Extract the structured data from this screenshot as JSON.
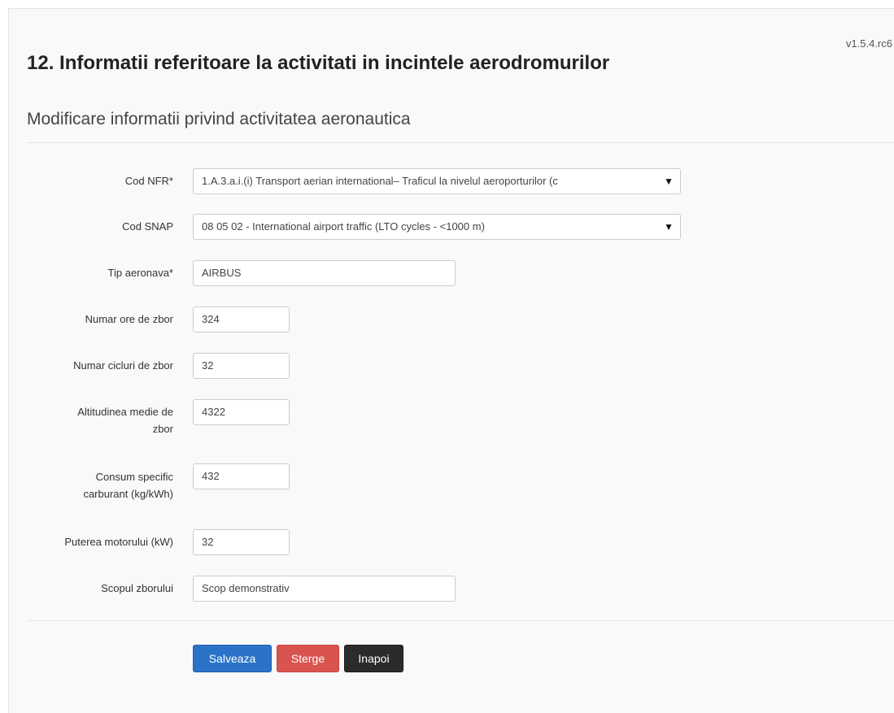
{
  "version": "v1.5.4.rc6",
  "page_title": "12. Informatii referitoare la activitati in incintele aerodromurilor",
  "subtitle": "Modificare informatii privind activitatea aeronautica",
  "form": {
    "cod_nfr": {
      "label": "Cod NFR*",
      "value": "1.A.3.a.i.(i) Transport aerian international– Traficul la nivelul aeroporturilor (c"
    },
    "cod_snap": {
      "label": "Cod SNAP",
      "value": "08 05 02 - International airport traffic (LTO cycles - <1000 m)"
    },
    "tip_aeronava": {
      "label": "Tip aeronava*",
      "value": "AIRBUS"
    },
    "numar_ore": {
      "label": "Numar ore de zbor",
      "value": "324"
    },
    "numar_cicluri": {
      "label": "Numar cicluri de zbor",
      "value": "32"
    },
    "altitudinea": {
      "label_line1": "Altitudinea medie de",
      "label_line2": "zbor",
      "value": "4322"
    },
    "consum": {
      "label_line1": "Consum specific",
      "label_line2": "carburant (kg/kWh)",
      "value": "432"
    },
    "puterea": {
      "label": "Puterea motorului (kW)",
      "value": "32"
    },
    "scopul": {
      "label": "Scopul zborului",
      "value": "Scop demonstrativ"
    }
  },
  "buttons": {
    "save": "Salveaza",
    "delete": "Sterge",
    "back": "Inapoi"
  },
  "colors": {
    "save": "#2a73c9",
    "delete": "#d9534f",
    "back": "#2b2b2b"
  },
  "icons": {
    "select_caret": "▼"
  }
}
